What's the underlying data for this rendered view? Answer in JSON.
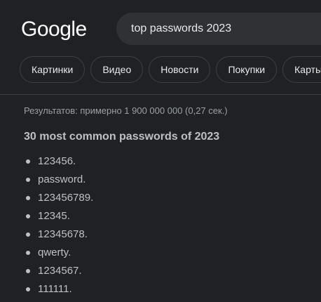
{
  "logo_text": "Google",
  "search": {
    "query": "top passwords 2023"
  },
  "chips": [
    {
      "label": "Картинки"
    },
    {
      "label": "Видео"
    },
    {
      "label": "Новости"
    },
    {
      "label": "Покупки"
    },
    {
      "label": "Карты"
    }
  ],
  "result_stats": "Результатов: примерно 1 900 000 000 (0,27 сек.)",
  "snippet": {
    "title": "30 most common passwords of 2023",
    "items": [
      "123456.",
      "password.",
      "123456789.",
      "12345.",
      "12345678.",
      "qwerty.",
      "1234567.",
      "111111."
    ]
  },
  "colors": {
    "background": "#202124",
    "search_box": "#303134",
    "text_primary": "#bdc1c6",
    "text_muted": "#9aa0a6",
    "border": "#3c4043"
  }
}
